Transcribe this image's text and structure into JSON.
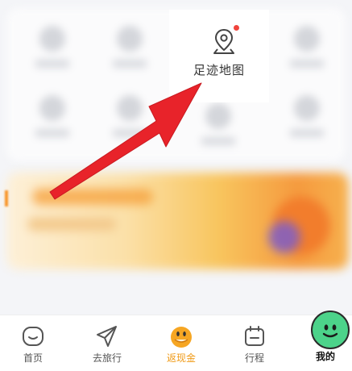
{
  "highlight": {
    "label": "足迹地图",
    "icon": "map-pin-icon",
    "badge_color": "#f0443c"
  },
  "annotation": {
    "arrow_color": "#e8232a"
  },
  "tabbar": {
    "tabs": [
      {
        "label": "首页",
        "icon": "home-icon",
        "active": false
      },
      {
        "label": "去旅行",
        "icon": "paper-plane-icon",
        "active": false
      },
      {
        "label": "返现金",
        "icon": "cashback-mascot-icon",
        "active": true
      },
      {
        "label": "行程",
        "icon": "calendar-icon",
        "active": false
      },
      {
        "label": "我的",
        "icon": "mascot-face-icon",
        "active": false
      }
    ],
    "active_color": "#f09a16",
    "mine_ball_color": "#4cd38a"
  }
}
